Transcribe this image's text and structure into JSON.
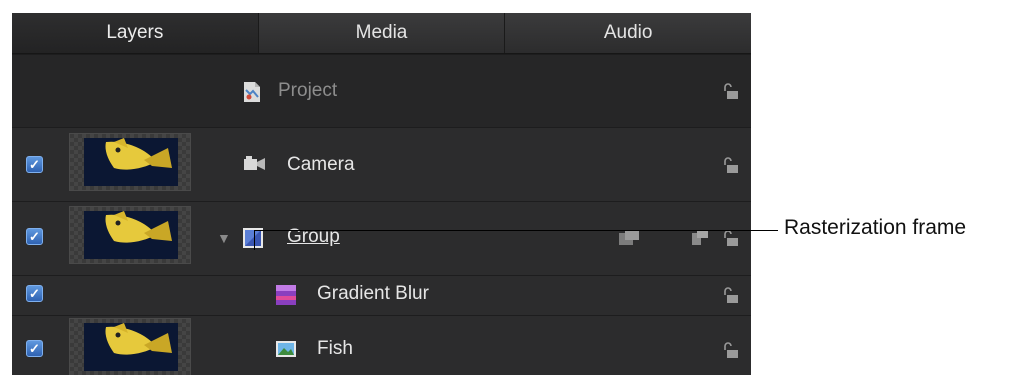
{
  "tabs": [
    "Layers",
    "Media",
    "Audio"
  ],
  "layers": {
    "project": "Project",
    "camera": "Camera",
    "group": "Group",
    "gradient_blur": "Gradient Blur",
    "fish": "Fish"
  },
  "checkbox_mark": "✓",
  "disclosure": "▼",
  "callout": "Rasterization frame",
  "colors": {
    "checkbox": "#3f7bd0",
    "panel": "#2a2a2b"
  },
  "icons": [
    "project-icon",
    "camera-icon",
    "group-icon",
    "filter-icon",
    "image-icon",
    "lock-icon",
    "render-icon",
    "blend-icon"
  ]
}
